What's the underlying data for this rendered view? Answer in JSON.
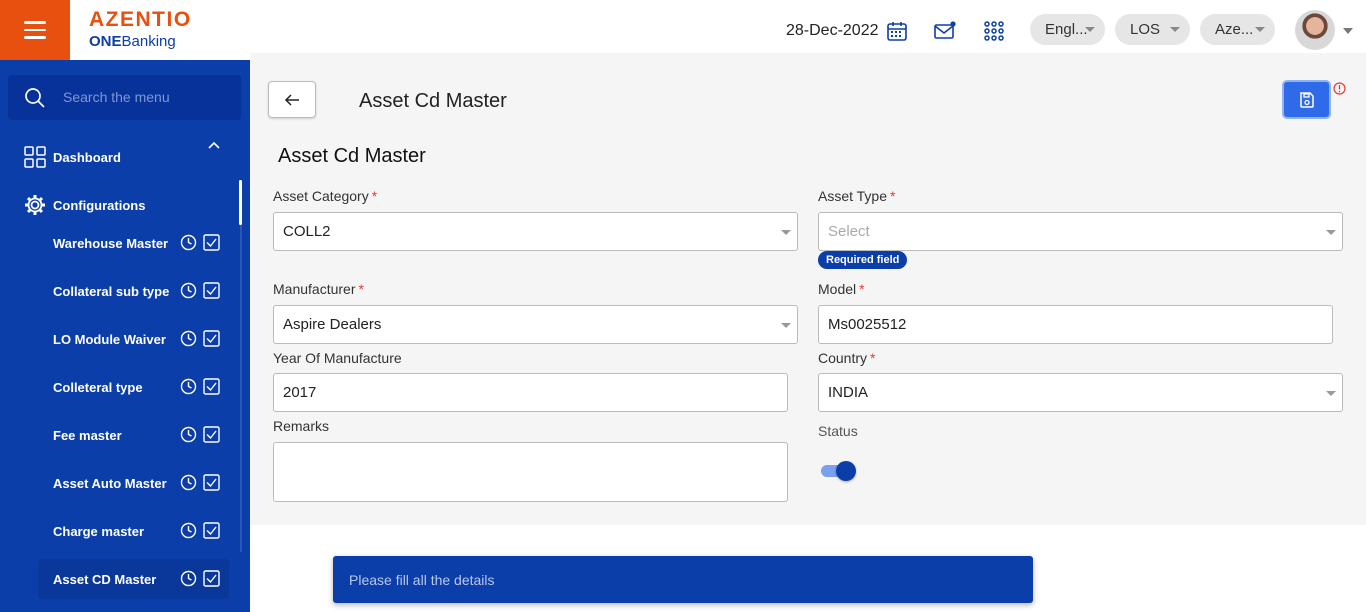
{
  "header": {
    "brand": "AZENTIO",
    "brand_sub_bold": "ONE",
    "brand_sub": "Banking",
    "date": "28-Dec-2022",
    "language": "Engl...",
    "module": "LOS",
    "entity": "Aze..."
  },
  "sidebar": {
    "search_placeholder": "Search the menu",
    "dashboard": "Dashboard",
    "configurations": "Configurations",
    "items": [
      {
        "label": "Warehouse Master"
      },
      {
        "label": "Collateral sub type"
      },
      {
        "label": "LO Module Waiver"
      },
      {
        "label": "Colleteral type"
      },
      {
        "label": "Fee master"
      },
      {
        "label": "Asset Auto Master"
      },
      {
        "label": "Charge master"
      },
      {
        "label": "Asset CD Master"
      }
    ]
  },
  "page": {
    "title": "Asset Cd Master",
    "section_title": "Asset Cd Master"
  },
  "form": {
    "asset_category": {
      "label": "Asset Category",
      "value": "COLL2"
    },
    "asset_type": {
      "label": "Asset Type",
      "placeholder": "Select",
      "error": "Required field"
    },
    "manufacturer": {
      "label": "Manufacturer",
      "value": "Aspire Dealers"
    },
    "model": {
      "label": "Model",
      "value": "Ms0025512"
    },
    "year": {
      "label": "Year Of Manufacture",
      "value": "2017"
    },
    "country": {
      "label": "Country",
      "value": "INDIA"
    },
    "remarks": {
      "label": "Remarks",
      "value": ""
    },
    "status": {
      "label": "Status",
      "on": true
    }
  },
  "required_marker": "*",
  "toast": {
    "message": "Please fill all the details"
  },
  "colors": {
    "brand_orange": "#e8500f",
    "brand_blue": "#0b3ea8",
    "primary_button": "#2f6be8",
    "error": "#e53935"
  }
}
